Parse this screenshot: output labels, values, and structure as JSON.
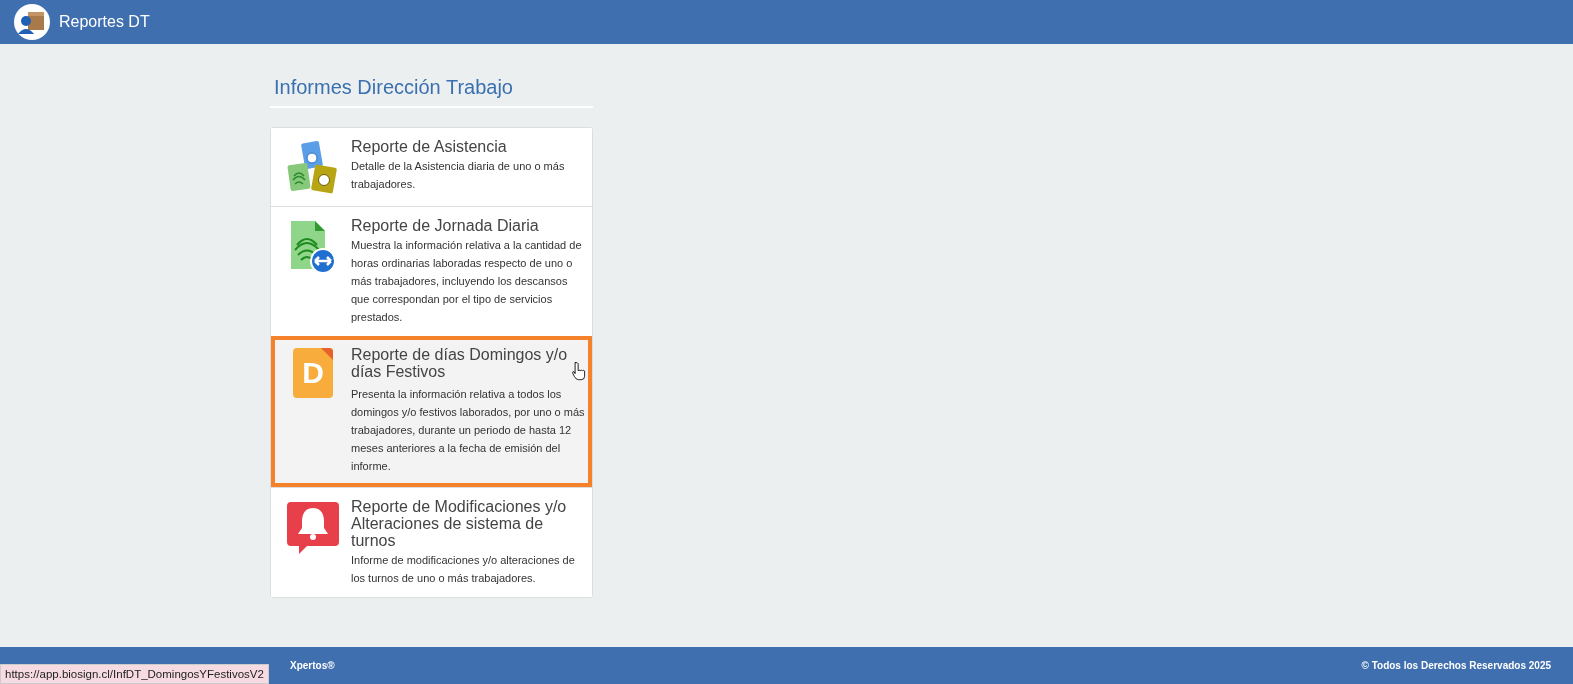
{
  "header": {
    "title": "Reportes DT"
  },
  "page": {
    "title": "Informes Dirección Trabajo"
  },
  "reports": [
    {
      "kind": "attendance",
      "title": "Reporte de Asistencia",
      "description": "Detalle de la Asistencia diaria de uno o más trabajadores.",
      "selected": false
    },
    {
      "kind": "workday",
      "title": "Reporte de Jornada Diaria",
      "description": "Muestra la información relativa a la cantidad de horas ordinarias laboradas respecto de uno o más trabajadores, incluyendo los descansos que correspondan por el tipo de servicios prestados.",
      "selected": false
    },
    {
      "kind": "letter",
      "icon_text": "D",
      "title": "Reporte de días Domingos y/o días Festivos",
      "description": "Presenta la información relativa a todos los domingos y/o festivos laborados, por uno o más trabajadores, durante un periodo de hasta 12 meses anteriores a la fecha de emisión del informe.",
      "selected": true
    },
    {
      "kind": "alert",
      "title": "Reporte de Modificaciones y/o Alteraciones de sistema de turnos",
      "description": "Informe de modificaciones y/o alteraciones de los turnos de uno o más trabajadores.",
      "selected": false
    }
  ],
  "footer": {
    "left_text": "Xpertos®",
    "right_text": "© Todos los Derechos Reservados 2025"
  },
  "status_url": "https://app.biosign.cl/InfDT_DomingosYFestivosV2"
}
